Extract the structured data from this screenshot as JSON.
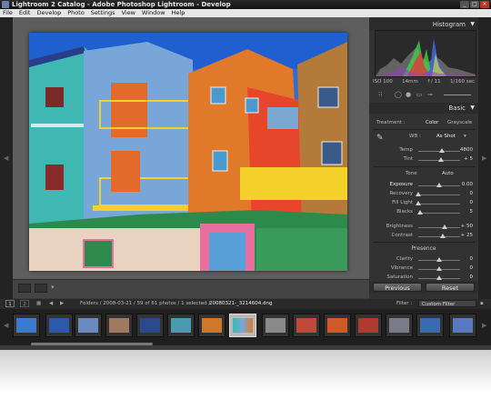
{
  "window": {
    "title": "Lightroom 2 Catalog - Adobe Photoshop Lightroom - Develop"
  },
  "menu": [
    "File",
    "Edit",
    "Develop",
    "Photo",
    "Settings",
    "View",
    "Window",
    "Help"
  ],
  "right_panel": {
    "histogram_label": "Histogram",
    "exif": {
      "iso": "ISO 100",
      "focal": "14mm",
      "aperture": "f / 11",
      "shutter": "1/160 sec"
    },
    "basic_label": "Basic",
    "treatment_label": "Treatment :",
    "treatment_color": "Color",
    "treatment_gray": "Grayscale",
    "wb_label": "WB :",
    "wb_value": "As Shot",
    "tone_label": "Tone",
    "auto_label": "Auto",
    "presence_label": "Presence",
    "sliders": {
      "temp": {
        "label": "Temp",
        "value": "4800",
        "pos": 0.57
      },
      "tint": {
        "label": "Tint",
        "value": "+ 5",
        "pos": 0.55
      },
      "exposure": {
        "label": "Exposure",
        "value": "0.00",
        "pos": 0.5
      },
      "recovery": {
        "label": "Recovery",
        "value": "0",
        "pos": 0.0
      },
      "fill_light": {
        "label": "Fill Light",
        "value": "0",
        "pos": 0.0
      },
      "blacks": {
        "label": "Blacks",
        "value": "5",
        "pos": 0.05
      },
      "brightness": {
        "label": "Brightness",
        "value": "+ 50",
        "pos": 0.63
      },
      "contrast": {
        "label": "Contrast",
        "value": "+ 25",
        "pos": 0.58
      },
      "clarity": {
        "label": "Clarity",
        "value": "0",
        "pos": 0.5
      },
      "vibrance": {
        "label": "Vibrance",
        "value": "0",
        "pos": 0.5
      },
      "saturation": {
        "label": "Saturation",
        "value": "0",
        "pos": 0.5
      }
    },
    "previous_label": "Previous",
    "reset_label": "Reset"
  },
  "navbar": {
    "page1": "1",
    "page2": "2",
    "path": "Folders / 2008-03-21 / 59 of 61 photos / 1 selected /",
    "filename": "20080321-_3214604.dng",
    "filter_label": "Filter :",
    "filter_value": "Custom Filter"
  },
  "colors": {
    "accent": "#d0d0d0",
    "panel": "#323232",
    "background": "#3b3b3b"
  }
}
